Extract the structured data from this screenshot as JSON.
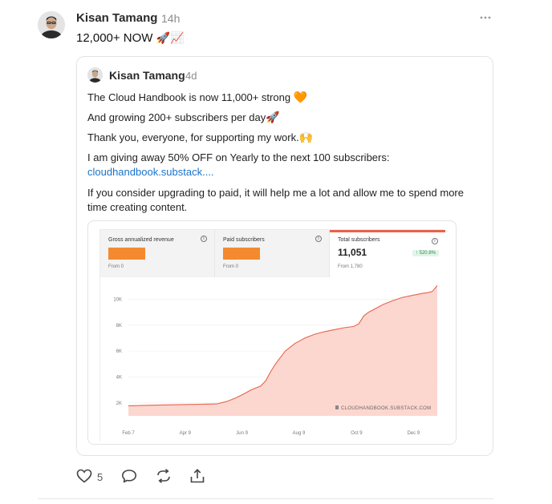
{
  "post": {
    "author": "Kisan Tamang",
    "time": "14h",
    "text": "12,000+ NOW",
    "text_emojis": "🚀📈",
    "like_count": "5"
  },
  "quote": {
    "author": "Kisan Tamang",
    "time": "4d",
    "line1": "The Cloud Handbook is now 11,000+ strong",
    "line1_emoji": "🧡",
    "line2": "And growing 200+ subscribers per day",
    "line2_emoji": "🚀",
    "line3": "Thank you, everyone, for supporting my work.",
    "line3_emoji": "🙌",
    "line4": "I am giving away 50% OFF on Yearly to the next 100 subscribers:",
    "link": "cloudhandbook.substack....",
    "line5a": "If you consider upgrading to paid, it will help me a lot and allow me to spend more",
    "line5b": "time creating content."
  },
  "stats": [
    {
      "label": "Gross annualized revenue",
      "from": "From 0",
      "value": ""
    },
    {
      "label": "Paid subscribers",
      "from": "From 0",
      "value": ""
    },
    {
      "label": "Total subscribers",
      "from": "From 1,780",
      "value": "11,051",
      "badge": "↑ 520.8%"
    }
  ],
  "colors": {
    "accent": "#e8634a",
    "redaction": "#f48a2f",
    "area_fill": "#fbd0c8",
    "link": "#1a73c9"
  },
  "icons": [
    "more-icon",
    "heart-icon",
    "comment-icon",
    "repost-icon",
    "share-icon",
    "info-icon",
    "substack-logo-icon"
  ],
  "chart_data": {
    "type": "area",
    "title": "Total subscribers",
    "x_tick_labels": [
      "Feb 7",
      "Apr 9",
      "Jun 9",
      "Aug 9",
      "Oct 9",
      "Dec 9"
    ],
    "y_tick_labels": [
      "2K",
      "4K",
      "6K",
      "8K",
      "10K"
    ],
    "ylim": [
      1000,
      11200
    ],
    "xlim": [
      0,
      315
    ],
    "watermark": "CLOUDHANDBOOK.SUBSTACK.COM",
    "grid": true,
    "x": [
      0,
      30,
      60,
      90,
      100,
      110,
      118,
      125,
      135,
      140,
      145,
      150,
      155,
      160,
      165,
      170,
      175,
      180,
      185,
      190,
      200,
      210,
      220,
      230,
      235,
      240,
      245,
      250,
      255,
      260,
      270,
      280,
      290,
      300,
      305,
      310,
      315
    ],
    "values": [
      1780,
      1830,
      1880,
      1920,
      2100,
      2400,
      2700,
      3000,
      3300,
      3700,
      4400,
      5000,
      5500,
      6000,
      6300,
      6600,
      6800,
      7000,
      7150,
      7300,
      7500,
      7650,
      7800,
      7900,
      8100,
      8700,
      9000,
      9200,
      9400,
      9600,
      9900,
      10150,
      10300,
      10450,
      10500,
      10600,
      11051
    ]
  }
}
